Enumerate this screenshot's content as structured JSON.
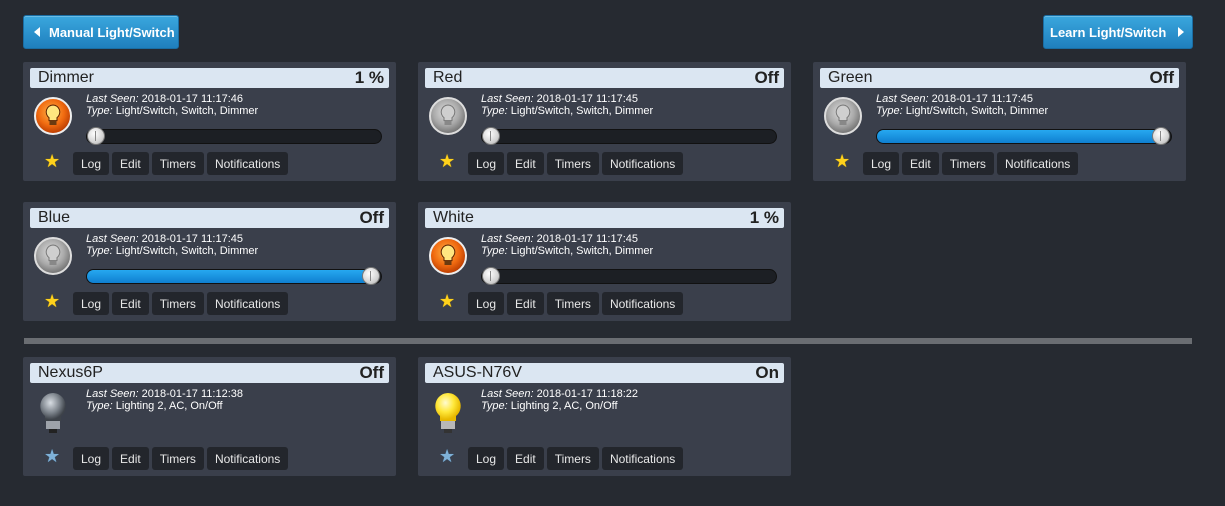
{
  "toolbar": {
    "left_button": "Manual Light/Switch",
    "right_button": "Learn Light/Switch"
  },
  "labels": {
    "last_seen": "Last Seen:",
    "type": "Type:"
  },
  "actions": [
    "Log",
    "Edit",
    "Timers",
    "Notifications"
  ],
  "devices": [
    {
      "name": "Dimmer",
      "status": "1 %",
      "last_seen": "2018-01-17 11:17:46",
      "type": "Light/Switch, Switch, Dimmer",
      "icon": "bulb-on-icon",
      "level": 0.0,
      "favorite": true
    },
    {
      "name": "Red",
      "status": "Off",
      "last_seen": "2018-01-17 11:17:45",
      "type": "Light/Switch, Switch, Dimmer",
      "icon": "bulb-off-icon",
      "level": 0.0,
      "favorite": true
    },
    {
      "name": "Green",
      "status": "Off",
      "last_seen": "2018-01-17 11:17:45",
      "type": "Light/Switch, Switch, Dimmer",
      "icon": "bulb-off-icon",
      "level": 0.96,
      "favorite": true
    },
    {
      "name": "Blue",
      "status": "Off",
      "last_seen": "2018-01-17 11:17:45",
      "type": "Light/Switch, Switch, Dimmer",
      "icon": "bulb-off-icon",
      "level": 0.96,
      "favorite": true
    },
    {
      "name": "White",
      "status": "1 %",
      "last_seen": "2018-01-17 11:17:45",
      "type": "Light/Switch, Switch, Dimmer",
      "icon": "bulb-on-icon",
      "level": 0.0,
      "favorite": true
    },
    {
      "name": "Nexus6P",
      "status": "Off",
      "last_seen": "2018-01-17 11:12:38",
      "type": "Lighting 2, AC, On/Off",
      "icon": "lightbulb-off-icon",
      "favorite": false
    },
    {
      "name": "ASUS-N76V",
      "status": "On",
      "last_seen": "2018-01-17 11:18:22",
      "type": "Lighting 2, AC, On/Off",
      "icon": "lightbulb-on-icon",
      "favorite": false
    }
  ],
  "colors": {
    "background": "#262a31",
    "card": "#3a3f4b",
    "title_bar": "#dbe6f2",
    "accent": "#1f8fd6",
    "slider_fill": "#1a93e0",
    "star_favorite": "#ffd21c",
    "star_normal": "#7fb2d9"
  }
}
